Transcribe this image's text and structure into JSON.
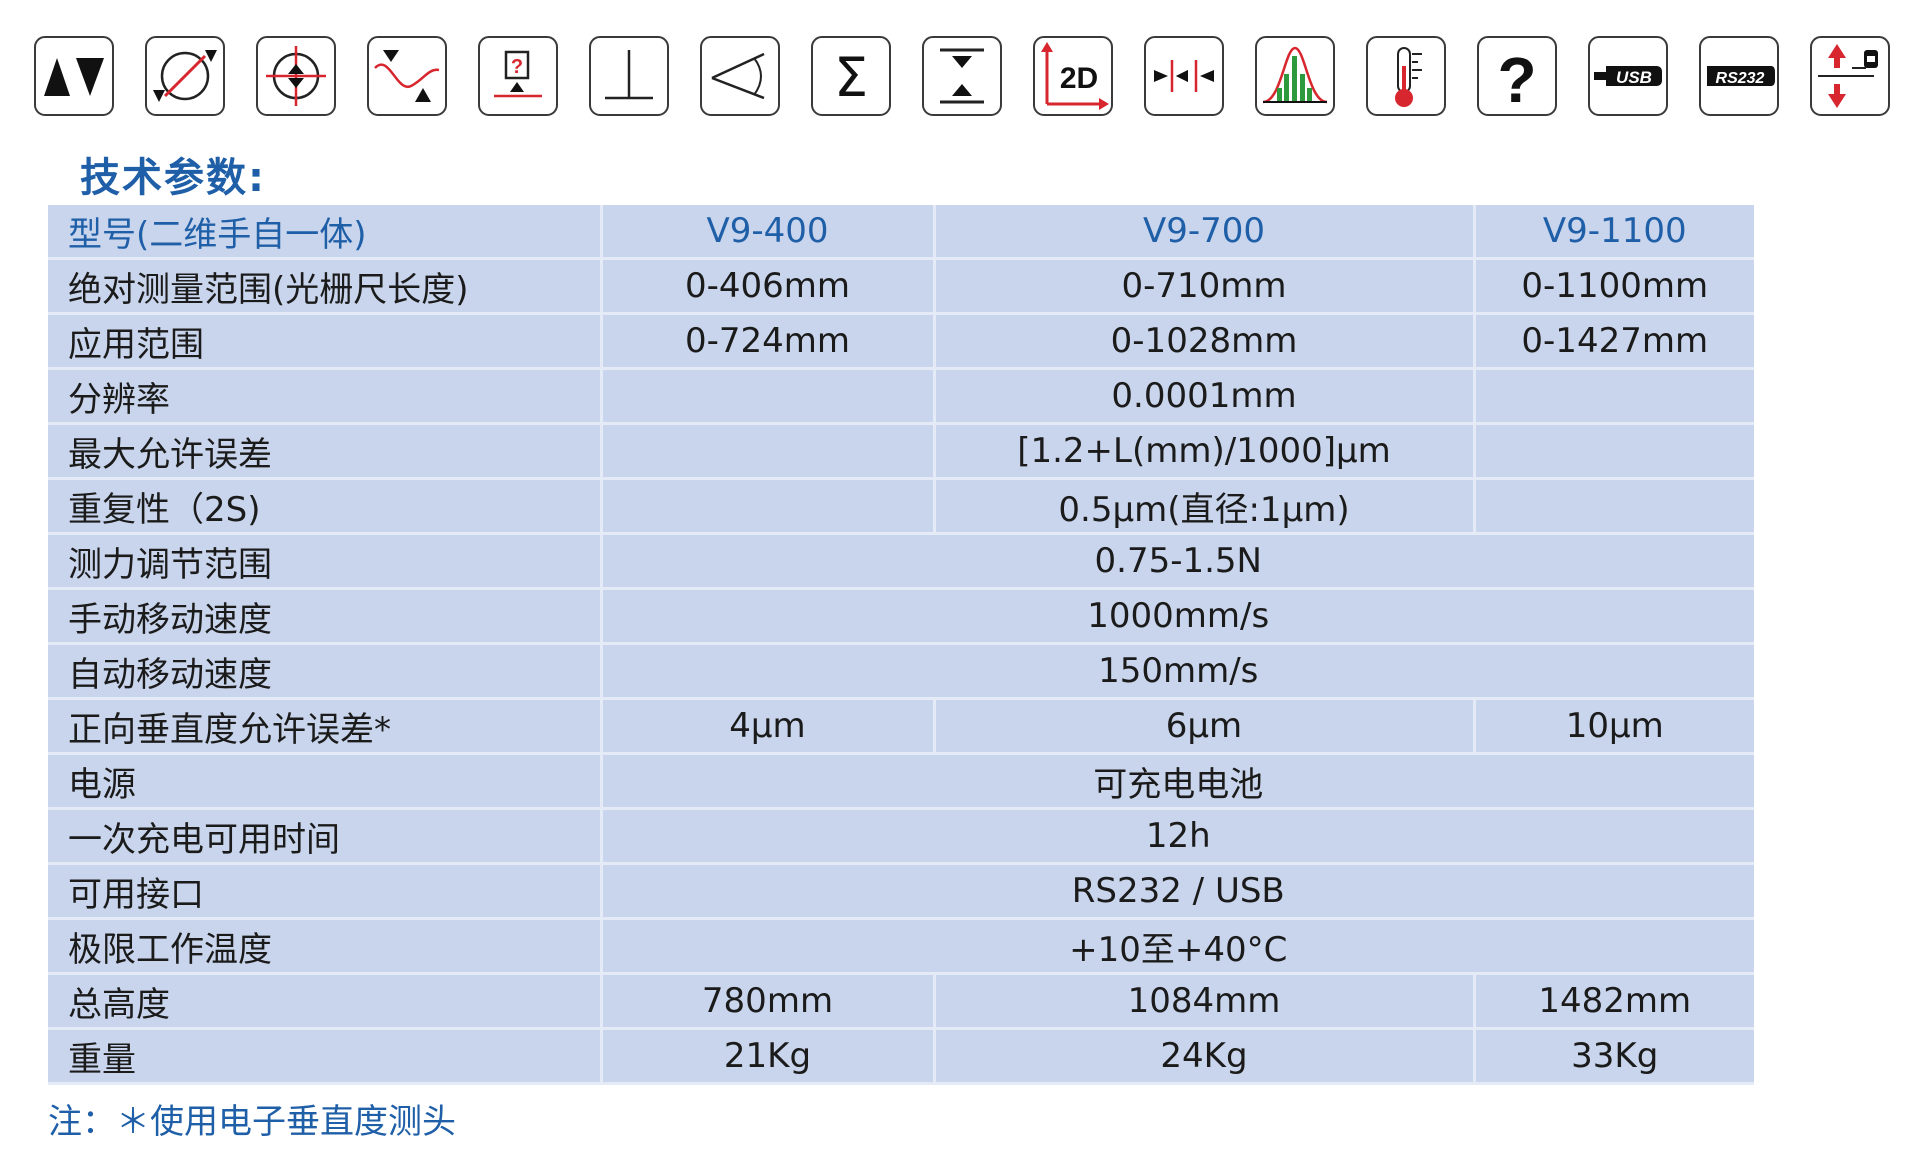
{
  "icons": [
    {
      "name": "up-down-arrows-icon"
    },
    {
      "name": "diameter-measure-icon"
    },
    {
      "name": "center-point-icon"
    },
    {
      "name": "min-max-curve-icon"
    },
    {
      "name": "unknown-point-icon"
    },
    {
      "name": "perpendicularity-icon"
    },
    {
      "name": "angle-icon"
    },
    {
      "name": "sigma-icon"
    },
    {
      "name": "height-distance-icon"
    },
    {
      "name": "two-d-measure-icon",
      "text": "2D"
    },
    {
      "name": "pitch-arrows-icon"
    },
    {
      "name": "statistics-histogram-icon"
    },
    {
      "name": "thermometer-icon"
    },
    {
      "name": "help-icon",
      "text": "?"
    },
    {
      "name": "usb-icon",
      "text": "USB"
    },
    {
      "name": "rs232-icon",
      "text": "RS232"
    },
    {
      "name": "probe-direction-icon"
    }
  ],
  "heading": "技术参数:",
  "table": {
    "header": {
      "label": "型号(二维手自一体)",
      "values": [
        "V9-400",
        "V9-700",
        "V9-1100"
      ]
    },
    "rows": [
      {
        "label": "绝对测量范围(光栅尺长度)",
        "values": [
          "0-406mm",
          "0-710mm",
          "0-1100mm"
        ]
      },
      {
        "label": "应用范围",
        "values": [
          "0-724mm",
          "0-1028mm",
          "0-1427mm"
        ]
      },
      {
        "label": "分辨率",
        "values": [
          "",
          "0.0001mm",
          ""
        ]
      },
      {
        "label": "最大允许误差",
        "values": [
          "",
          "[1.2+L(mm)/1000]μm",
          ""
        ]
      },
      {
        "label": "重复性（2S)",
        "values": [
          "",
          "0.5μm(直径:1μm)",
          ""
        ]
      },
      {
        "label": "测力调节范围",
        "values": [
          "0.75-1.5N"
        ]
      },
      {
        "label": "手动移动速度",
        "values": [
          "1000mm/s"
        ]
      },
      {
        "label": "自动移动速度",
        "values": [
          "150mm/s"
        ]
      },
      {
        "label": "正向垂直度允许误差*",
        "values": [
          "4μm",
          "6μm",
          "10μm"
        ]
      },
      {
        "label": "电源",
        "values": [
          "可充电电池"
        ]
      },
      {
        "label": "一次充电可用时间",
        "values": [
          "12h"
        ]
      },
      {
        "label": "可用接口",
        "values": [
          "RS232 / USB"
        ]
      },
      {
        "label": "极限工作温度",
        "values": [
          "+10至+40°C"
        ]
      },
      {
        "label": "总高度",
        "values": [
          "780mm",
          "1084mm",
          "1482mm"
        ]
      },
      {
        "label": "重量",
        "values": [
          "21Kg",
          "24Kg",
          "33Kg"
        ]
      }
    ]
  },
  "note": "注：＊使用电子垂直度测头",
  "colors": {
    "accent": "#1f5fa8",
    "table_bg": "#c9d5ec",
    "table_line": "#e4ebf6",
    "red": "#d7262e",
    "green": "#2e9a3e"
  }
}
